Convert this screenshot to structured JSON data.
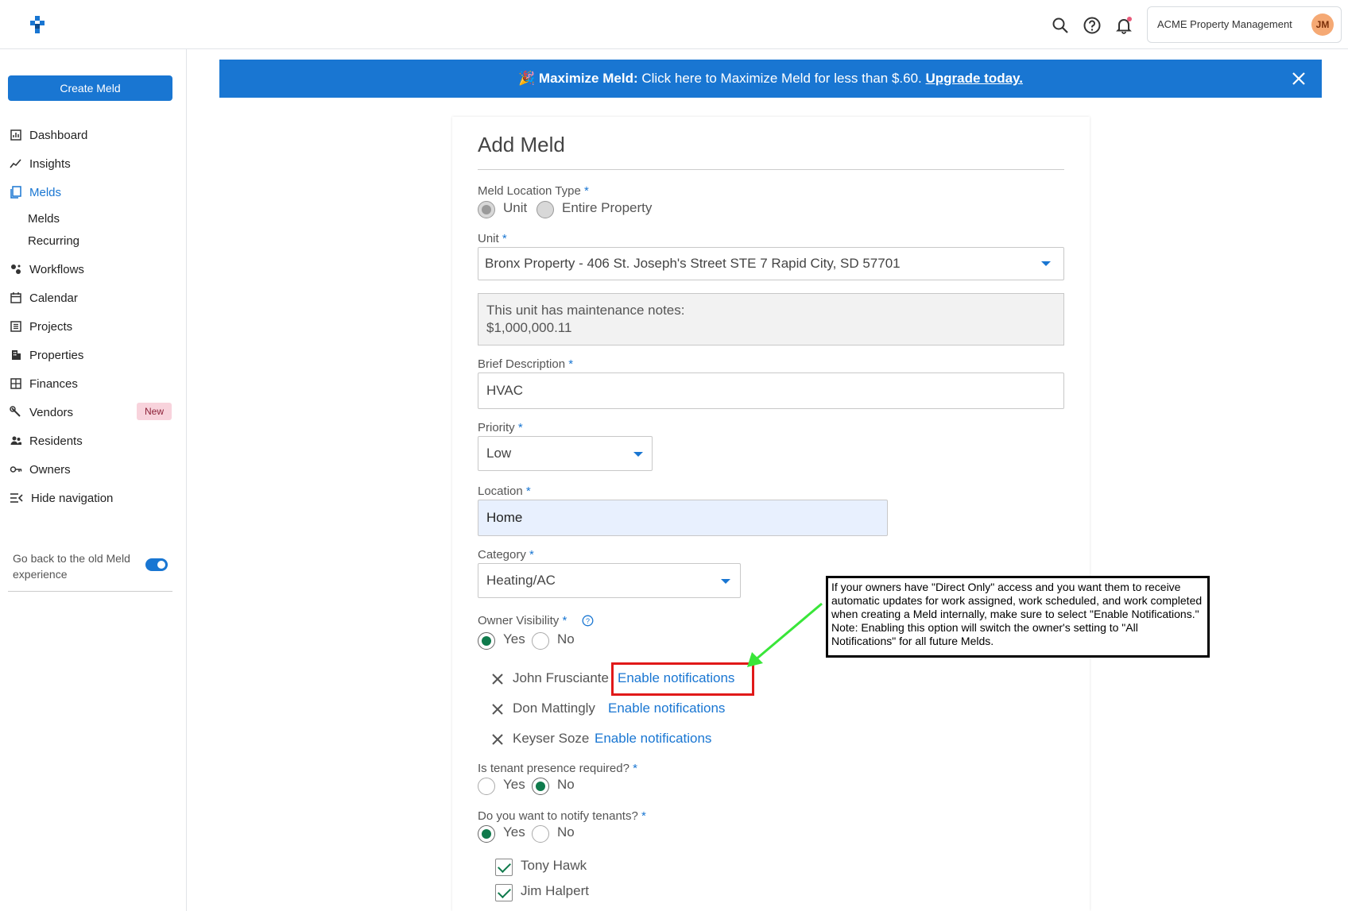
{
  "topbar": {
    "org_name": "ACME Property Management",
    "avatar_initials": "JM",
    "icons": [
      "search-icon",
      "help-icon",
      "bell-icon"
    ]
  },
  "sidebar": {
    "create_label": "Create Meld",
    "items": [
      {
        "label": "Dashboard",
        "icon": "dashboard-icon"
      },
      {
        "label": "Insights",
        "icon": "insights-icon"
      },
      {
        "label": "Melds",
        "icon": "melds-icon",
        "active": true
      },
      {
        "label": "Workflows",
        "icon": "workflows-icon"
      },
      {
        "label": "Calendar",
        "icon": "calendar-icon"
      },
      {
        "label": "Projects",
        "icon": "projects-icon"
      },
      {
        "label": "Properties",
        "icon": "properties-icon"
      },
      {
        "label": "Finances",
        "icon": "finances-icon"
      },
      {
        "label": "Vendors",
        "icon": "vendors-icon"
      },
      {
        "label": "Residents",
        "icon": "residents-icon"
      },
      {
        "label": "Owners",
        "icon": "owners-icon"
      },
      {
        "label": "Hide navigation",
        "icon": "hide-nav-icon"
      }
    ],
    "sub_items": [
      "Melds",
      "Recurring"
    ],
    "new_badge": "New",
    "old_experience_label": "Go back to the old Meld experience",
    "old_experience_enabled": true
  },
  "banner": {
    "emoji": "🎉",
    "bold": "Maximize Meld:",
    "text": " Click here to Maximize Meld for less than $.60. ",
    "link": "Upgrade today."
  },
  "form": {
    "title": "Add Meld",
    "location_type": {
      "label": "Meld Location Type",
      "required": "*",
      "options": [
        "Unit",
        "Entire Property"
      ],
      "selected": "Unit"
    },
    "unit": {
      "label": "Unit",
      "required": "*",
      "value": "Bronx Property - 406 St. Joseph's Street STE 7 Rapid City, SD 57701"
    },
    "maintenance_notes": {
      "line1": "This unit has maintenance notes:",
      "line2": "$1,000,000.11"
    },
    "brief_description": {
      "label": "Brief Description",
      "required": "*",
      "value": "HVAC"
    },
    "priority": {
      "label": "Priority",
      "required": "*",
      "value": "Low"
    },
    "location": {
      "label": "Location",
      "required": "*",
      "value": "Home"
    },
    "category": {
      "label": "Category",
      "required": "*",
      "value": "Heating/AC"
    },
    "owner_visibility": {
      "label": "Owner Visibility",
      "required": "*",
      "options": [
        "Yes",
        "No"
      ],
      "selected": "Yes",
      "owners": [
        {
          "name": "John Frusciante",
          "action": "Enable notifications"
        },
        {
          "name": "Don Mattingly",
          "action": "Enable notifications"
        },
        {
          "name": "Keyser Soze",
          "action": "Enable notifications"
        }
      ]
    },
    "tenant_presence": {
      "label": "Is tenant presence required?",
      "required": "*",
      "options": [
        "Yes",
        "No"
      ],
      "selected": "No"
    },
    "notify_tenants": {
      "label": "Do you want to notify tenants?",
      "required": "*",
      "options": [
        "Yes",
        "No"
      ],
      "selected": "Yes",
      "tenants": [
        "Tony Hawk",
        "Jim Halpert"
      ]
    }
  },
  "annotation": {
    "callout_text": "If your owners have \"Direct Only\" access and you want them to receive automatic updates for work assigned, work scheduled, and work completed when creating a Meld internally, make sure to select \"Enable Notifications.\" Note: Enabling this option will switch the owner's setting to \"All Notifications\" for all future Melds.",
    "highlight_color": "#e01919",
    "arrow_color": "#39e639"
  },
  "colors": {
    "accent": "#1976d2",
    "selected_radio": "#0f7a4c",
    "location_field_bg": "#e8f0fe"
  }
}
